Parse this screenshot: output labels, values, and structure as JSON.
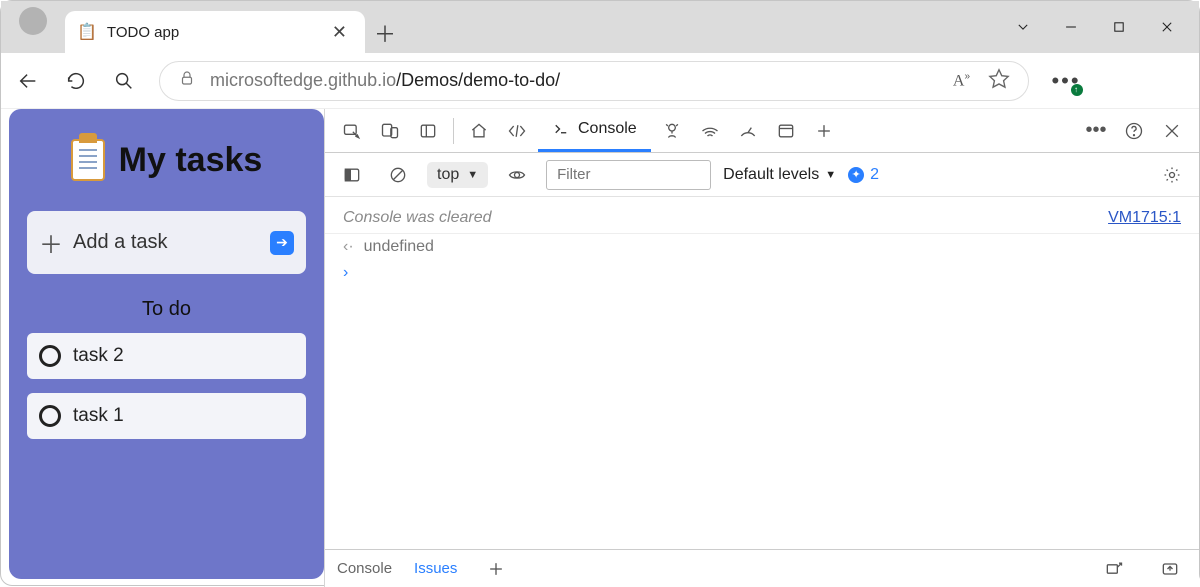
{
  "browser": {
    "tab_title": "TODO app",
    "tab_icon": "📋",
    "url_gray_before": "microsoftedge.github.io",
    "url_dark": "/Demos/demo-to-do/",
    "read_aloud_label": "A»"
  },
  "app": {
    "title": "My tasks",
    "add_task": "Add a task",
    "todo_heading": "To do",
    "tasks": [
      {
        "name": "task 2"
      },
      {
        "name": "task 1"
      }
    ]
  },
  "devtools": {
    "tab_console": "Console",
    "scope": "top",
    "filter_placeholder": "Filter",
    "levels_label": "Default levels",
    "issue_count": "2",
    "cleared_msg": "Console was cleared",
    "cleared_src": "VM1715:1",
    "undefined_text": "undefined",
    "drawer_console": "Console",
    "drawer_issues": "Issues"
  }
}
